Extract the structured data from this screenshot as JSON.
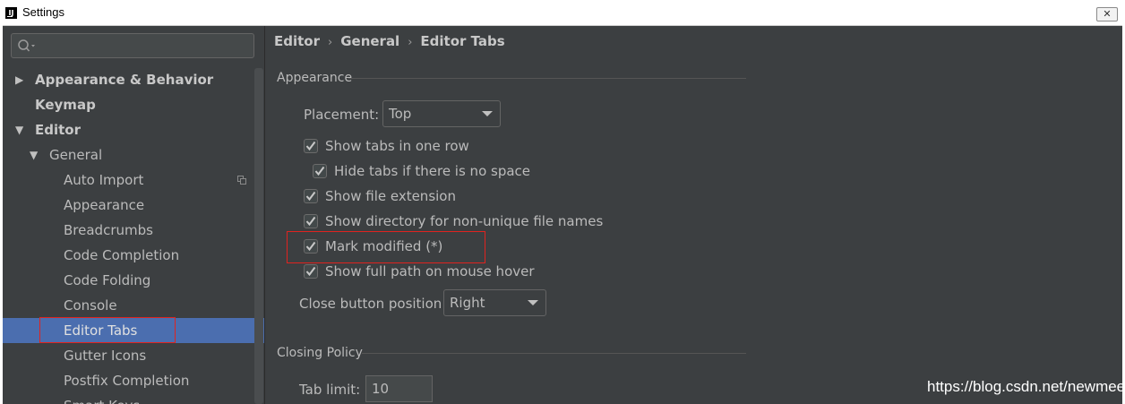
{
  "window": {
    "title": "Settings",
    "app_icon": "IJ",
    "close_glyph": "✕"
  },
  "sidebar": {
    "search": {
      "value": "",
      "placeholder": ""
    },
    "items": [
      {
        "label": "Appearance & Behavior",
        "level": 0,
        "expanded": false,
        "bold": true
      },
      {
        "label": "Keymap",
        "level": 0,
        "bold": true
      },
      {
        "label": "Editor",
        "level": 0,
        "expanded": true,
        "bold": true
      },
      {
        "label": "General",
        "level": 1,
        "expanded": true
      },
      {
        "label": "Auto Import",
        "level": 2,
        "icon": "copy-icon"
      },
      {
        "label": "Appearance",
        "level": 2
      },
      {
        "label": "Breadcrumbs",
        "level": 2
      },
      {
        "label": "Code Completion",
        "level": 2
      },
      {
        "label": "Code Folding",
        "level": 2
      },
      {
        "label": "Console",
        "level": 2
      },
      {
        "label": "Editor Tabs",
        "level": 2,
        "selected": true
      },
      {
        "label": "Gutter Icons",
        "level": 2
      },
      {
        "label": "Postfix Completion",
        "level": 2
      },
      {
        "label": "Smart Keys",
        "level": 2
      }
    ]
  },
  "main": {
    "breadcrumb": [
      "Editor",
      "General",
      "Editor Tabs"
    ],
    "breadcrumb_sep": "›",
    "appearance": {
      "title": "Appearance",
      "placement_label": "Placement:",
      "placement_value": "Top",
      "checkboxes": [
        {
          "label": "Show tabs in one row",
          "checked": true
        },
        {
          "label": "Hide tabs if there is no space",
          "checked": true
        },
        {
          "label": "Show file extension",
          "checked": true
        },
        {
          "label": "Show directory for non-unique file names",
          "checked": true
        },
        {
          "label": "Mark modified (*)",
          "checked": true
        },
        {
          "label": "Show full path on mouse hover",
          "checked": true
        }
      ],
      "close_button_label": "Close button position:",
      "close_button_value": "Right"
    },
    "closing_policy": {
      "title": "Closing Policy",
      "tab_limit_label": "Tab limit:",
      "tab_limit_value": "10"
    }
  },
  "watermark": "https://blog.csdn.net/newmeet",
  "colors": {
    "background": "#3c3f41",
    "selection": "#4b6eaf",
    "highlight_box": "#e0231f",
    "text": "#bbbbbb"
  }
}
